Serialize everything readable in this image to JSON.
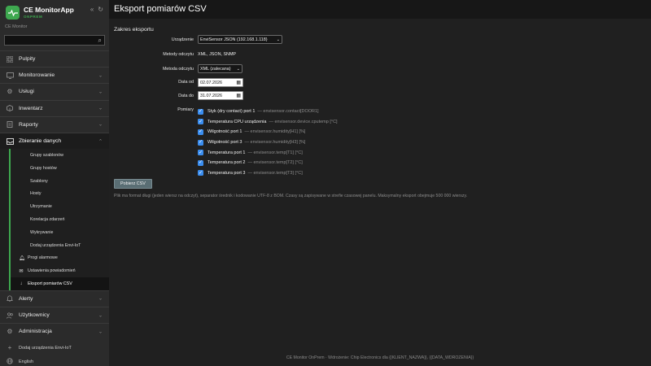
{
  "app": {
    "name": "CE MonitorApp",
    "edition": "ONPREM",
    "caption": "CE Monitor",
    "search_placeholder": ""
  },
  "sidebar": {
    "items": [
      {
        "label": "Pulpity",
        "icon": "dashboard-icon",
        "expandable": false
      },
      {
        "label": "Monitorowanie",
        "icon": "monitor-icon",
        "expandable": true
      },
      {
        "label": "Usługi",
        "icon": "gear-icon",
        "expandable": true
      },
      {
        "label": "Inwentarz",
        "icon": "box-icon",
        "expandable": true
      },
      {
        "label": "Raporty",
        "icon": "report-icon",
        "expandable": true
      },
      {
        "label": "Zbieranie danych",
        "icon": "inbox-icon",
        "expandable": true,
        "active": true
      }
    ],
    "sub_items": [
      {
        "label": "Grupy szablonów"
      },
      {
        "label": "Grupy hostów"
      },
      {
        "label": "Szablony"
      },
      {
        "label": "Hosty"
      },
      {
        "label": "Utrzymanie"
      },
      {
        "label": "Korelacja zdarzeń"
      },
      {
        "label": "Wykrywanie"
      },
      {
        "label": "Dodaj urządzenia Envi-IoT"
      },
      {
        "label": "Progi alarmowe",
        "icon": "bell-icon"
      },
      {
        "label": "Ustawienia powiadomień",
        "icon": "envelope-icon"
      },
      {
        "label": "Eksport pomiarów CSV",
        "icon": "download-icon",
        "current": true
      }
    ],
    "items_after": [
      {
        "label": "Alerty",
        "icon": "bell-icon",
        "expandable": true
      },
      {
        "label": "Użytkownicy",
        "icon": "users-icon",
        "expandable": true
      },
      {
        "label": "Administracja",
        "icon": "gear-icon",
        "expandable": true
      }
    ],
    "bottom": [
      {
        "label": "Dodaj urządzenia Envi-IoT",
        "icon": "plus-icon"
      },
      {
        "label": "English",
        "icon": "globe-icon"
      }
    ]
  },
  "page": {
    "title": "Eksport pomiarów CSV",
    "section": "Zakres eksportu",
    "labels": {
      "device": "Urządzenie",
      "read_methods": "Metody odczytu",
      "read_method": "Metoda odczytu",
      "date_from": "Data od",
      "date_to": "Data do",
      "measurements": "Pomiary"
    },
    "device_value": "EnviSensor JSON (192.168.1.118)",
    "read_methods_value": "XML, JSON, SNMP",
    "read_method_value": "XML (zalecana)",
    "date_from_value": "02.07.2026",
    "date_to_value": "31.07.2026",
    "measurements": [
      {
        "label": "Styk (dry contact) port 1",
        "hint": "— envisensor.contact[DOOR1]",
        "checked": true
      },
      {
        "label": "Temperatura CPU urządzenia",
        "hint": "— envisensor.device.cputemp [°C]",
        "checked": true
      },
      {
        "label": "Wilgotność port 1",
        "hint": "— envisensor.humidity[H1] [%]",
        "checked": true
      },
      {
        "label": "Wilgotność port 3",
        "hint": "— envisensor.humidity[H3] [%]",
        "checked": true
      },
      {
        "label": "Temperatura port 1",
        "hint": "— envisensor.temp[T1] [°C]",
        "checked": true
      },
      {
        "label": "Temperatura port 2",
        "hint": "— envisensor.temp[T2] [°C]",
        "checked": true
      },
      {
        "label": "Temperatura port 3",
        "hint": "— envisensor.temp[T3] [°C]",
        "checked": true
      }
    ],
    "button_label": "Pobierz CSV",
    "note": "Plik ma format długi (jeden wiersz na odczyt), separator średnik i kodowanie UTF-8 z BOM. Czasy są zapisywane w strefie czasowej panelu. Maksymalny eksport obejmuje 500 000 wierszy.",
    "footer": "CE Monitor OnPrem · Wdrożenie: Chip Electronics dla {{KLIENT_NAZWA}}, {{DATA_WDROZENIA}}"
  },
  "colors": {
    "accent": "#3ea84f",
    "checkbox": "#3b8ef0",
    "sidebar_bg": "#2b2b2b",
    "main_bg": "#202020"
  }
}
